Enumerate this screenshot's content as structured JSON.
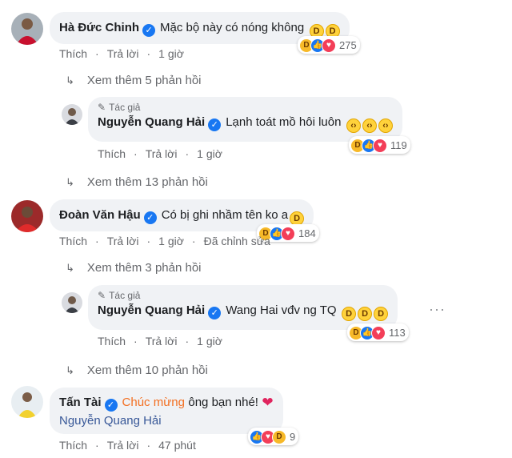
{
  "comments": [
    {
      "name": "Hà Đức Chinh",
      "text": "Mặc bộ này có nóng không",
      "actions": [
        "Thích",
        "Trả lời",
        "1 giờ"
      ],
      "reaction_count": "275"
    },
    {
      "author_badge": "Tác giả",
      "name": "Nguyễn Quang Hải",
      "text": "Lạnh toát mồ hôi luôn",
      "actions": [
        "Thích",
        "Trả lời",
        "1 giờ"
      ],
      "reaction_count": "119"
    },
    {
      "name": "Đoàn Văn Hậu",
      "text": "Có bị ghi nhầm tên ko a",
      "actions": [
        "Thích",
        "Trả lời",
        "1 giờ",
        "Đã chỉnh sửa"
      ],
      "reaction_count": "184"
    },
    {
      "author_badge": "Tác giả",
      "name": "Nguyễn Quang Hải",
      "text": "Wang Hai vđv ng TQ",
      "actions": [
        "Thích",
        "Trả lời",
        "1 giờ"
      ],
      "reaction_count": "113"
    },
    {
      "name": "Tấn Tài",
      "highlight": "Chúc mừng",
      "text": "ông bạn nhé!",
      "mention": "Nguyễn Quang Hải",
      "actions": [
        "Thích",
        "Trả lời",
        "47 phút"
      ],
      "reaction_count": "9"
    }
  ],
  "more_replies": [
    "Xem thêm 5 phản hồi",
    "Xem thêm 13 phản hồi",
    "Xem thêm 3 phản hồi",
    "Xem thêm 10 phản hồi"
  ],
  "colors": {
    "verified": "#1877f2",
    "bubble": "#f0f2f5",
    "meta": "#65676b",
    "highlight": "#f36f21"
  },
  "icons": [
    "verified-icon",
    "pencil-icon",
    "laugh-emoji",
    "sad-emoji",
    "heart-emoji",
    "like-reaction",
    "love-reaction",
    "haha-reaction",
    "more-options-icon",
    "reply-arrow-icon"
  ]
}
